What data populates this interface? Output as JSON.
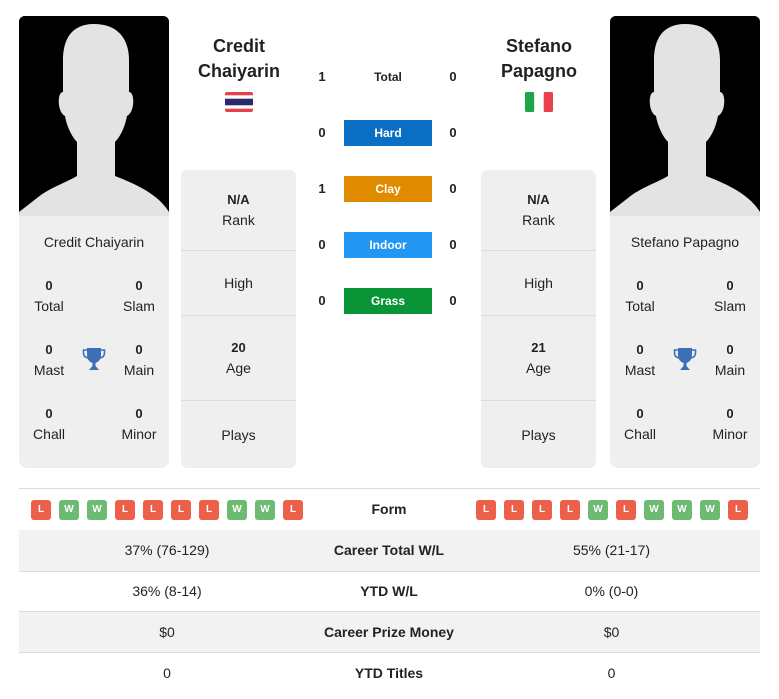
{
  "player1": {
    "name_line1": "Credit",
    "name_line2": "Chaiyarin",
    "full_name": "Credit Chaiyarin",
    "country_flag": "thailand-flag",
    "titles": {
      "total": "0",
      "total_label": "Total",
      "slam": "0",
      "slam_label": "Slam",
      "mast": "0",
      "mast_label": "Mast",
      "main": "0",
      "main_label": "Main",
      "chall": "0",
      "chall_label": "Chall",
      "minor": "0",
      "minor_label": "Minor"
    },
    "info": {
      "rank_value": "N/A",
      "rank_label": "Rank",
      "high_label": "High",
      "age_value": "20",
      "age_label": "Age",
      "plays_label": "Plays"
    },
    "form": [
      "L",
      "W",
      "W",
      "L",
      "L",
      "L",
      "L",
      "W",
      "W",
      "L"
    ]
  },
  "player2": {
    "name_line1": "Stefano",
    "name_line2": "Papagno",
    "full_name": "Stefano Papagno",
    "country_flag": "italy-flag",
    "titles": {
      "total": "0",
      "total_label": "Total",
      "slam": "0",
      "slam_label": "Slam",
      "mast": "0",
      "mast_label": "Mast",
      "main": "0",
      "main_label": "Main",
      "chall": "0",
      "chall_label": "Chall",
      "minor": "0",
      "minor_label": "Minor"
    },
    "info": {
      "rank_value": "N/A",
      "rank_label": "Rank",
      "high_label": "High",
      "age_value": "21",
      "age_label": "Age",
      "plays_label": "Plays"
    },
    "form": [
      "L",
      "L",
      "L",
      "L",
      "W",
      "L",
      "W",
      "W",
      "W",
      "L"
    ]
  },
  "h2h": [
    {
      "label": "Total",
      "p1": "1",
      "p2": "0",
      "color": ""
    },
    {
      "label": "Hard",
      "p1": "0",
      "p2": "0",
      "color": "#0a6fc2"
    },
    {
      "label": "Clay",
      "p1": "1",
      "p2": "0",
      "color": "#e08a00"
    },
    {
      "label": "Indoor",
      "p1": "0",
      "p2": "0",
      "color": "#2196f3"
    },
    {
      "label": "Grass",
      "p1": "0",
      "p2": "0",
      "color": "#0a9438"
    }
  ],
  "comparison": {
    "form_label": "Form",
    "rows": [
      {
        "label": "Career Total W/L",
        "p1": "37% (76-129)",
        "p2": "55% (21-17)"
      },
      {
        "label": "YTD W/L",
        "p1": "36% (8-14)",
        "p2": "0% (0-0)"
      },
      {
        "label": "Career Prize Money",
        "p1": "$0",
        "p2": "$0"
      },
      {
        "label": "YTD Titles",
        "p1": "0",
        "p2": "0"
      }
    ]
  },
  "colors": {
    "loss": "#ec5f48",
    "win": "#6dbb72",
    "trophy": "#3d6fb6"
  }
}
